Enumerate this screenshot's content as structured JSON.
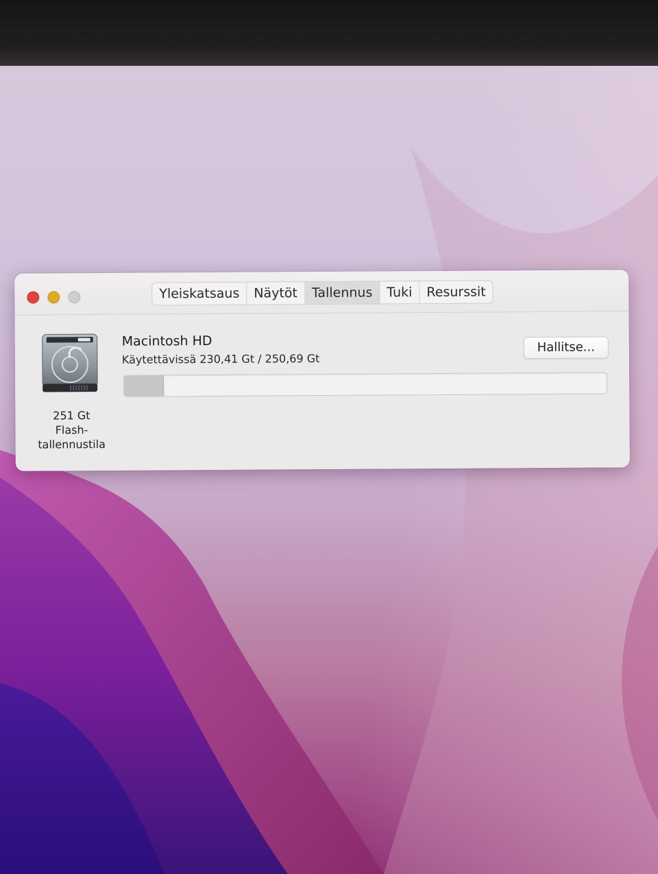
{
  "window": {
    "tabs": [
      {
        "label": "Yleiskatsaus"
      },
      {
        "label": "Näytöt"
      },
      {
        "label": "Tallennus",
        "active": true
      },
      {
        "label": "Tuki"
      },
      {
        "label": "Resurssit"
      }
    ]
  },
  "disk": {
    "icon": "hard-drive-icon",
    "capacity_label": "251 Gt",
    "type_label_line1": "Flash-",
    "type_label_line2": "tallennustila"
  },
  "volume": {
    "name": "Macintosh HD",
    "availability": "Käytettävissä 230,41 Gt / 250,69 Gt",
    "available_gb": 230.41,
    "total_gb": 250.69,
    "manage_label": "Hallitse..."
  },
  "colors": {
    "close": "#e0443e",
    "minimize": "#dcab28",
    "zoom_disabled": "#cfcdcf",
    "used_bar": "#c6c6c6"
  }
}
